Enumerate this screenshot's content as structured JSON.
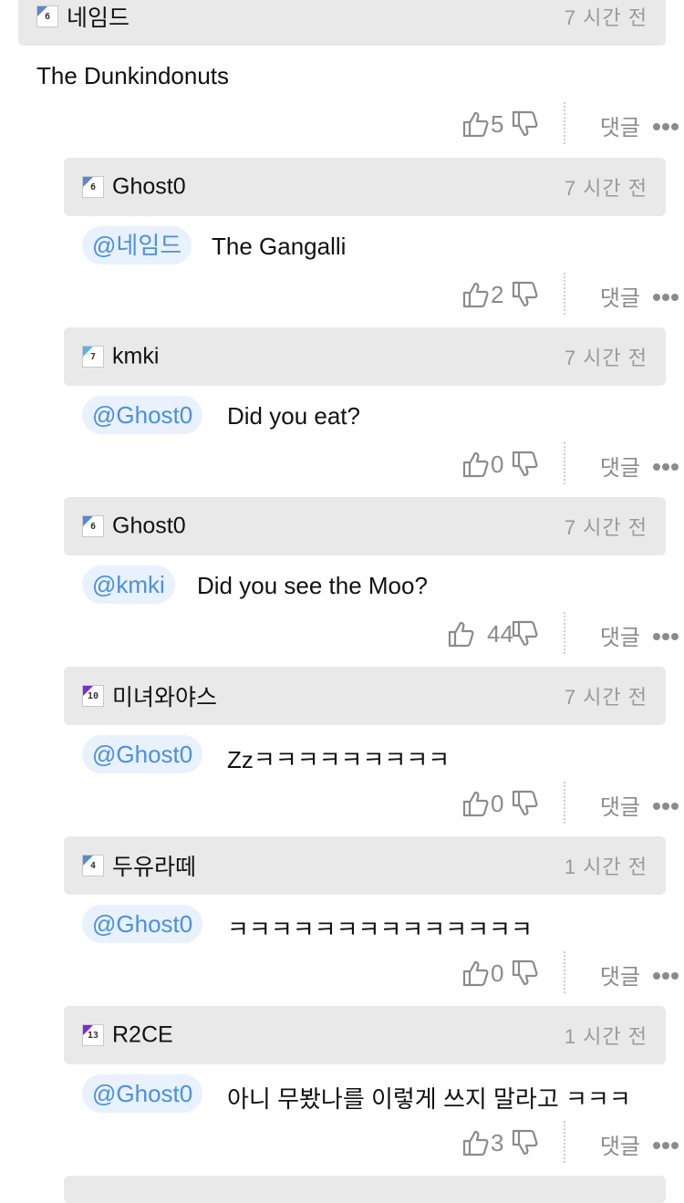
{
  "comments": [
    {
      "level": "6",
      "levelColor": "#5b86d6",
      "user": "네임드",
      "time": "7 시간 전",
      "mention": "",
      "text": "The Dunkindonuts",
      "likes": "5",
      "reply": "댓글"
    },
    {
      "level": "6",
      "levelColor": "#5b86d6",
      "user": "Ghost0",
      "time": "7 시간 전",
      "mention": "@네임드",
      "text": "The Gangalli",
      "likes": "2",
      "reply": "댓글"
    },
    {
      "level": "7",
      "levelColor": "#5ab3e6",
      "user": "kmki",
      "time": "7 시간 전",
      "mention": "@Ghost0",
      "text": "Did you eat?",
      "likes": "0",
      "reply": "댓글"
    },
    {
      "level": "6",
      "levelColor": "#5b86d6",
      "user": "Ghost0",
      "time": "7 시간 전",
      "mention": "@kmki",
      "text": "Did you see the Moo?",
      "likes": "44",
      "reply": "댓글"
    },
    {
      "level": "10",
      "levelColor": "#7b2bd6",
      "user": "미녀와야스",
      "time": "7 시간 전",
      "mention": "@Ghost0",
      "text": "Zzㅋㅋㅋㅋㅋㅋㅋㅋㅋ",
      "likes": "0",
      "reply": "댓글"
    },
    {
      "level": "4",
      "levelColor": "#5b86d6",
      "user": "두유라떼",
      "time": "1 시간 전",
      "mention": "@Ghost0",
      "text": "ㅋㅋㅋㅋㅋㅋㅋㅋㅋㅋㅋㅋㅋㅋ",
      "likes": "0",
      "reply": "댓글"
    },
    {
      "level": "13",
      "levelColor": "#7b2bd6",
      "user": "R2CE",
      "time": "1 시간 전",
      "mention": "@Ghost0",
      "text": "아니 무봤나를 이렇게 쓰지 말라고 ㅋㅋㅋ",
      "likes": "3",
      "reply": "댓글"
    }
  ]
}
